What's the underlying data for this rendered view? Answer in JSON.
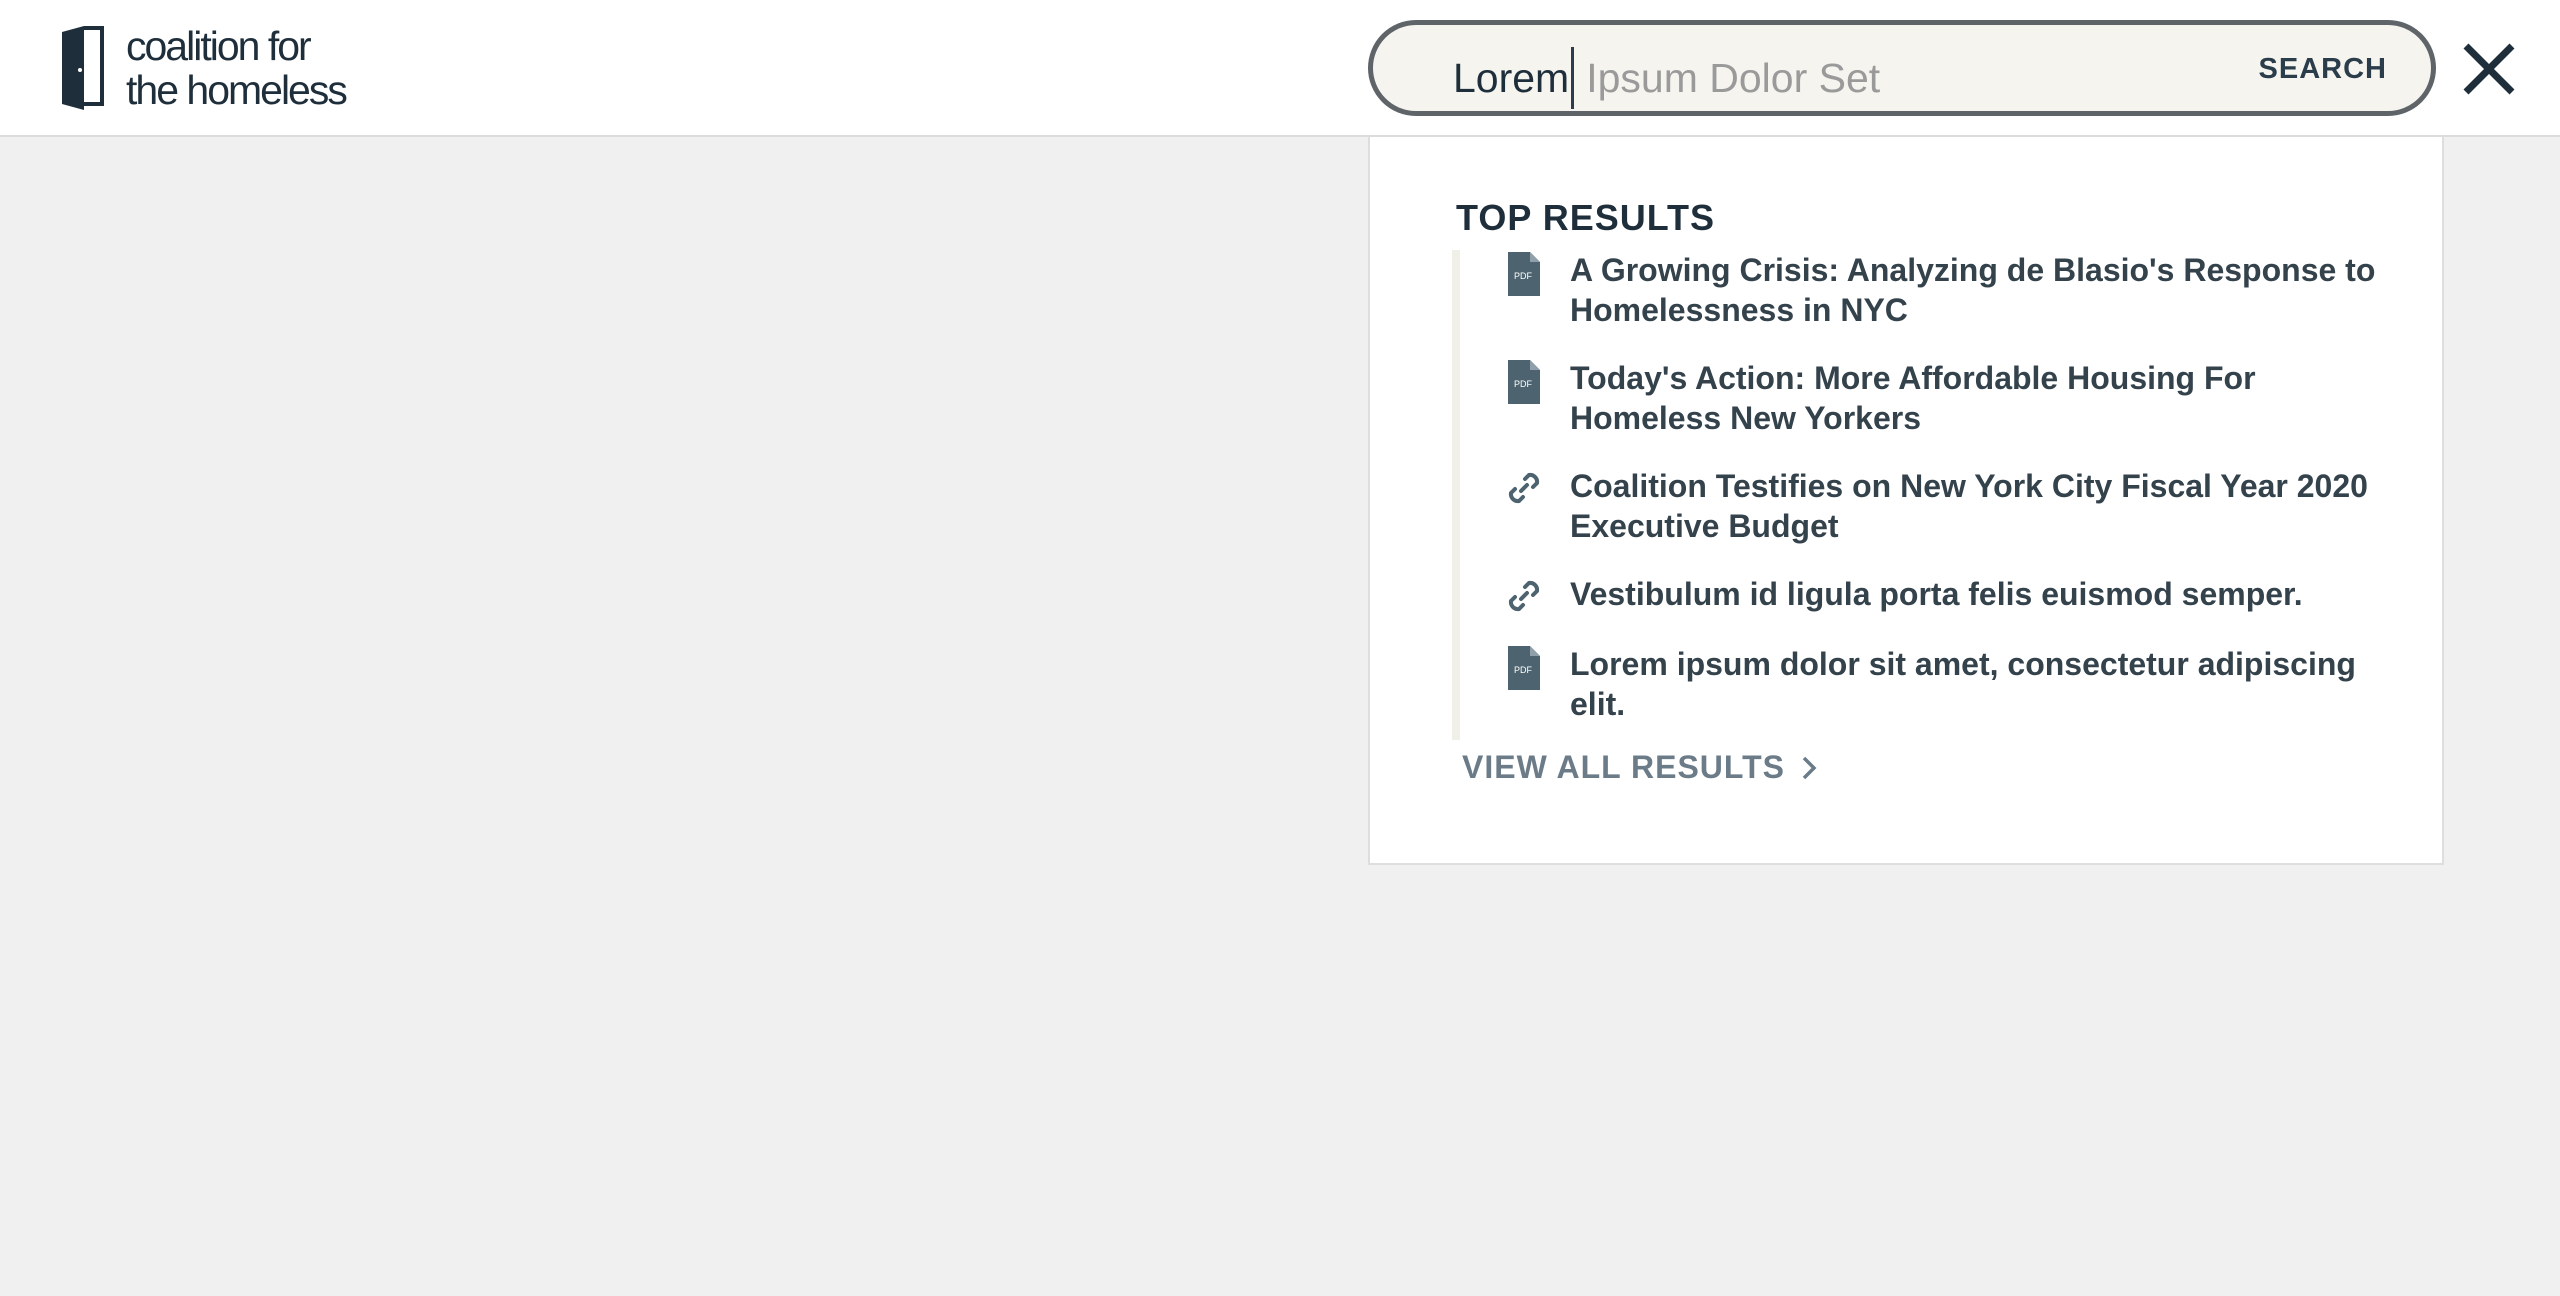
{
  "brand": {
    "line1": "coalition for",
    "line2": "the homeless"
  },
  "search": {
    "typed": "Lorem",
    "placeholder": "Ipsum Dolor Set",
    "button_label": "SEARCH"
  },
  "results": {
    "heading": "TOP RESULTS",
    "items": [
      {
        "icon": "pdf-icon",
        "title": "A Growing Crisis: Analyzing de Blasio's Response to Homelessness in NYC"
      },
      {
        "icon": "pdf-icon",
        "title": "Today's Action: More Affordable Housing For Homeless New Yorkers"
      },
      {
        "icon": "link-icon",
        "title": "Coalition Testifies on New York City Fiscal Year 2020 Executive Budget"
      },
      {
        "icon": "link-icon",
        "title": "Vestibulum id ligula porta felis euismod semper."
      },
      {
        "icon": "pdf-icon",
        "title": "Lorem ipsum dolor sit amet, consectetur adipiscing elit."
      }
    ],
    "view_all_label": "VIEW ALL RESULTS",
    "pdf_badge": "PDF"
  },
  "colors": {
    "brand_dark": "#1e2e3a",
    "icon": "#4d6470",
    "background": "#f0f0f0"
  }
}
